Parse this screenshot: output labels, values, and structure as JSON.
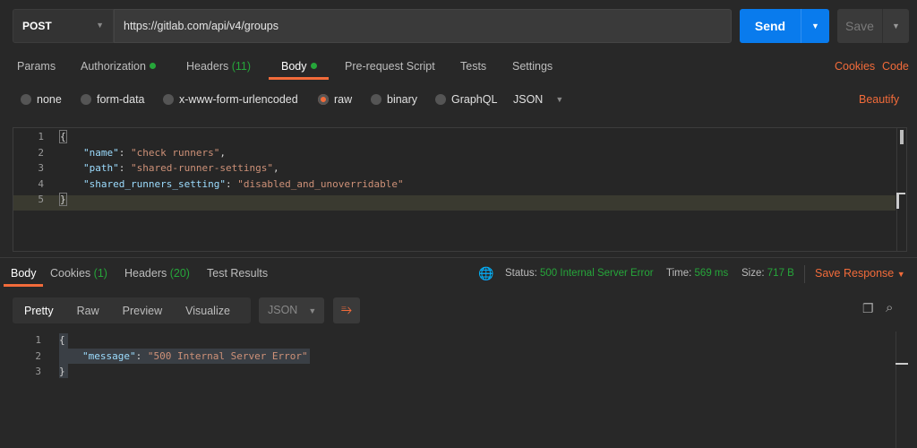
{
  "request": {
    "method": "POST",
    "url": "https://gitlab.com/api/v4/groups",
    "send": "Send",
    "save": "Save"
  },
  "tabs": {
    "params": "Params",
    "authorization": "Authorization",
    "headers": "Headers",
    "headers_count": "(11)",
    "body": "Body",
    "prerequest": "Pre-request Script",
    "tests": "Tests",
    "settings": "Settings",
    "cookies": "Cookies",
    "code": "Code"
  },
  "body_types": {
    "none": "none",
    "form_data": "form-data",
    "urlencoded": "x-www-form-urlencoded",
    "raw": "raw",
    "binary": "binary",
    "graphql": "GraphQL",
    "format": "JSON",
    "beautify": "Beautify"
  },
  "request_body": {
    "lines": [
      "1",
      "2",
      "3",
      "4",
      "5"
    ],
    "open": "{",
    "close": "}",
    "k1": "\"name\"",
    "v1": "\"check runners\"",
    "k2": "\"path\"",
    "v2": "\"shared-runner-settings\"",
    "k3": "\"shared_runners_setting\"",
    "v3": "\"disabled_and_unoverridable\""
  },
  "response_tabs": {
    "body": "Body",
    "cookies": "Cookies",
    "cookies_count": "(1)",
    "headers": "Headers",
    "headers_count": "(20)",
    "test_results": "Test Results"
  },
  "status": {
    "status_label": "Status:",
    "status_value": "500 Internal Server Error",
    "time_label": "Time:",
    "time_value": "569 ms",
    "size_label": "Size:",
    "size_value": "717 B",
    "save_response": "Save Response"
  },
  "view": {
    "pretty": "Pretty",
    "raw": "Raw",
    "preview": "Preview",
    "visualize": "Visualize",
    "format": "JSON"
  },
  "response_body": {
    "lines": [
      "1",
      "2",
      "3"
    ],
    "open": "{",
    "close": "}",
    "k1": "\"message\"",
    "v1": "\"500 Internal Server Error\""
  }
}
